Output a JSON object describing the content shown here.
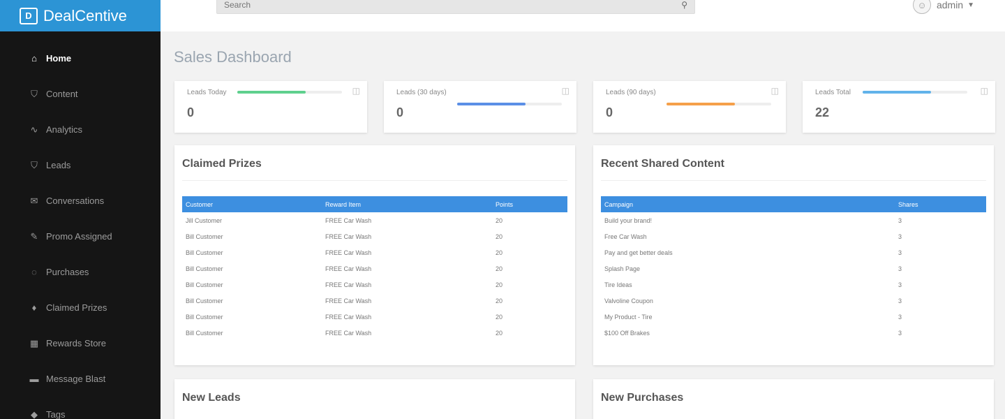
{
  "brand": {
    "logo_glyph": "D",
    "name": "DealCentive"
  },
  "search": {
    "placeholder": "Search"
  },
  "user": {
    "name": "admin",
    "avatar_glyph": "☺"
  },
  "sidebar": {
    "items": [
      {
        "label": "Home",
        "icon": "home-icon",
        "glyph": "⌂",
        "active": true
      },
      {
        "label": "Content",
        "icon": "shield-icon",
        "glyph": "⛉"
      },
      {
        "label": "Analytics",
        "icon": "chart-line-icon",
        "glyph": "∿"
      },
      {
        "label": "Leads",
        "icon": "badge-icon",
        "glyph": "⛉"
      },
      {
        "label": "Conversations",
        "icon": "chat-icon",
        "glyph": "✉"
      },
      {
        "label": "Promo Assigned",
        "icon": "pen-icon",
        "glyph": "✎"
      },
      {
        "label": "Purchases",
        "icon": "cart-icon",
        "glyph": "◌"
      },
      {
        "label": "Claimed Prizes",
        "icon": "trophy-icon",
        "glyph": "♦"
      },
      {
        "label": "Rewards Store",
        "icon": "calendar-icon",
        "glyph": "▦"
      },
      {
        "label": "Message Blast",
        "icon": "message-icon",
        "glyph": "▬"
      },
      {
        "label": "Tags",
        "icon": "tag-icon",
        "glyph": "◆"
      }
    ]
  },
  "page": {
    "title": "Sales Dashboard"
  },
  "stats": [
    {
      "label": "Leads Today",
      "value": "0",
      "progress": 0.65,
      "color": "#5fd08e"
    },
    {
      "label": "Leads (30 days)",
      "value": "0",
      "progress": 0.65,
      "color": "#5b8fe6"
    },
    {
      "label": "Leads (90 days)",
      "value": "0",
      "progress": 0.65,
      "color": "#f5a04a"
    },
    {
      "label": "Leads Total",
      "value": "22",
      "progress": 0.65,
      "color": "#62b3ea"
    }
  ],
  "claimed_prizes": {
    "title": "Claimed Prizes",
    "columns": [
      "Customer",
      "Reward Item",
      "Points"
    ],
    "rows": [
      [
        "Jill Customer",
        "FREE Car Wash",
        "20"
      ],
      [
        "Bill Customer",
        "FREE Car Wash",
        "20"
      ],
      [
        "Bill Customer",
        "FREE Car Wash",
        "20"
      ],
      [
        "Bill Customer",
        "FREE Car Wash",
        "20"
      ],
      [
        "Bill Customer",
        "FREE Car Wash",
        "20"
      ],
      [
        "Bill Customer",
        "FREE Car Wash",
        "20"
      ],
      [
        "Bill Customer",
        "FREE Car Wash",
        "20"
      ],
      [
        "Bill Customer",
        "FREE Car Wash",
        "20"
      ]
    ]
  },
  "recent_shared": {
    "title": "Recent Shared Content",
    "columns": [
      "Campaign",
      "Shares"
    ],
    "rows": [
      [
        "Build your brand!",
        "3"
      ],
      [
        "Free Car Wash",
        "3"
      ],
      [
        "Pay and get better deals",
        "3"
      ],
      [
        "Splash Page",
        "3"
      ],
      [
        "Tire Ideas",
        "3"
      ],
      [
        "Valvoline Coupon",
        "3"
      ],
      [
        "My Product - Tire",
        "3"
      ],
      [
        "$100 Off Brakes",
        "3"
      ]
    ]
  },
  "new_leads": {
    "title": "New Leads"
  },
  "new_purchases": {
    "title": "New Purchases"
  },
  "colors": {
    "brand_blue": "#2c94d5",
    "table_header": "#3d8fe0",
    "sidebar_bg": "#151515"
  }
}
